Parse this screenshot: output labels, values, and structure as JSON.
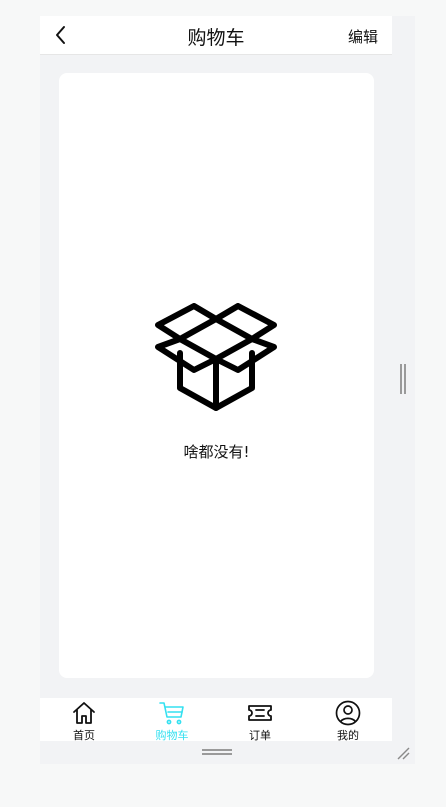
{
  "header": {
    "title": "购物车",
    "edit_label": "编辑"
  },
  "empty_state": {
    "icon": "open-box-icon",
    "message": "啥都没有!"
  },
  "tabbar": {
    "items": [
      {
        "label": "首页",
        "icon": "home-icon",
        "active": false
      },
      {
        "label": "购物车",
        "icon": "cart-icon",
        "active": true
      },
      {
        "label": "订单",
        "icon": "ticket-icon",
        "active": false
      },
      {
        "label": "我的",
        "icon": "user-icon",
        "active": false
      }
    ],
    "active_color": "#34e0f0"
  }
}
